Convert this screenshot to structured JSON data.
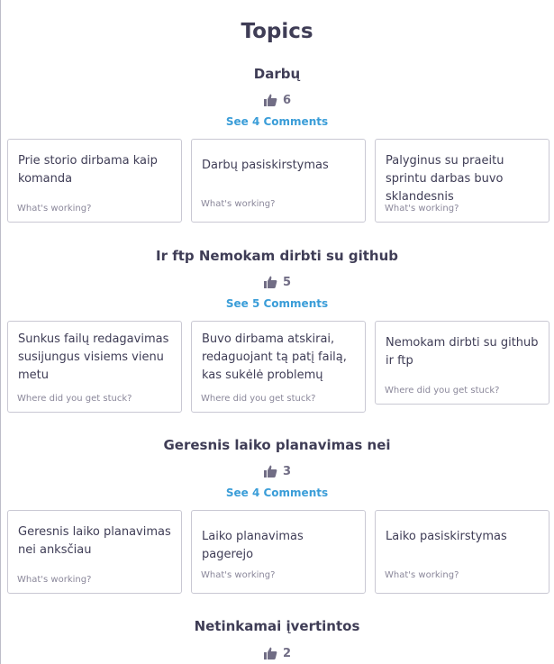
{
  "page": {
    "title": "Topics"
  },
  "topics": [
    {
      "title": "Darbų",
      "votes": "6",
      "comments": "See 4 Comments",
      "cards": [
        {
          "text": "Prie storio dirbama kaip komanda",
          "prompt": "What's working?"
        },
        {
          "text": "Darbų pasiskirstymas",
          "prompt": "What's working?"
        },
        {
          "text": "Palyginus su praeitu sprintu darbas buvo sklandesnis",
          "prompt": "What's working?"
        }
      ]
    },
    {
      "title": "Ir ftp Nemokam dirbti su github",
      "votes": "5",
      "comments": "See 5 Comments",
      "cards": [
        {
          "text": "Sunkus failų redagavimas susijungus visiems vienu metu",
          "prompt": "Where did you get stuck?"
        },
        {
          "text": "Buvo dirbama atskirai, redaguojant tą patį failą, kas sukėlė problemų",
          "prompt": "Where did you get stuck?"
        },
        {
          "text": "Nemokam dirbti su github ir ftp",
          "prompt": "Where did you get stuck?"
        }
      ]
    },
    {
      "title": "Geresnis laiko planavimas nei",
      "votes": "3",
      "comments": "See 4 Comments",
      "cards": [
        {
          "text": "Geresnis laiko planavimas nei anksčiau",
          "prompt": "What's working?"
        },
        {
          "text": "Laiko planavimas pagerejo",
          "prompt": "What's working?"
        },
        {
          "text": "Laiko pasiskirstymas",
          "prompt": "What's working?"
        }
      ]
    },
    {
      "title": "Netinkamai įvertintos",
      "votes": "2"
    }
  ],
  "colors": {
    "text": "#3f3d56",
    "link": "#3a9dd8",
    "muted": "#8a879a",
    "border": "#c9c8d3"
  },
  "icons": {
    "vote": "thumbs-up-icon"
  }
}
